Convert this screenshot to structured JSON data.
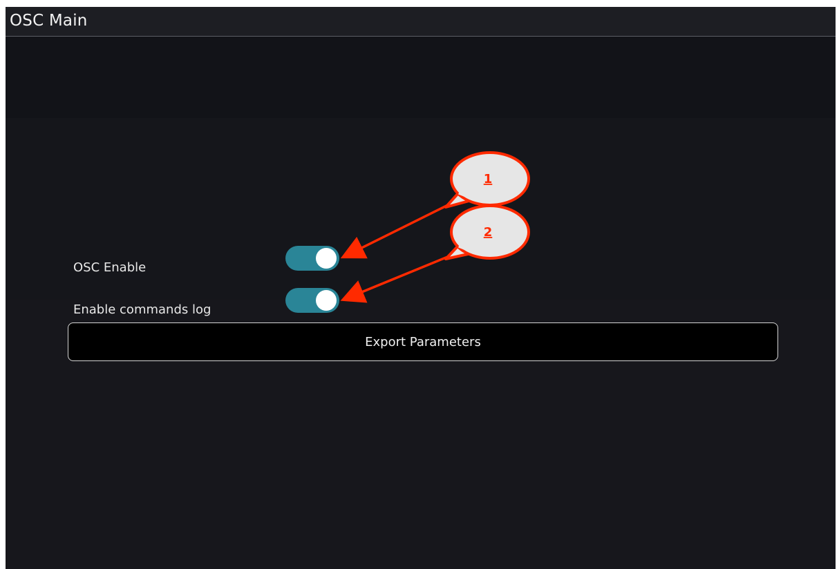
{
  "window": {
    "title": "OSC Main"
  },
  "settings": {
    "osc_enable": {
      "label": "OSC Enable",
      "state": "on"
    },
    "commands_log": {
      "label": "Enable commands log",
      "state": "on"
    }
  },
  "actions": {
    "export_label": "Export Parameters"
  },
  "annotations": {
    "callout_1": "1",
    "callout_2": "2"
  },
  "colors": {
    "background": "#17171c",
    "toggle_on": "#2a8597",
    "annotation_red": "#ff2a00",
    "callout_fill": "#e6e6e6"
  }
}
